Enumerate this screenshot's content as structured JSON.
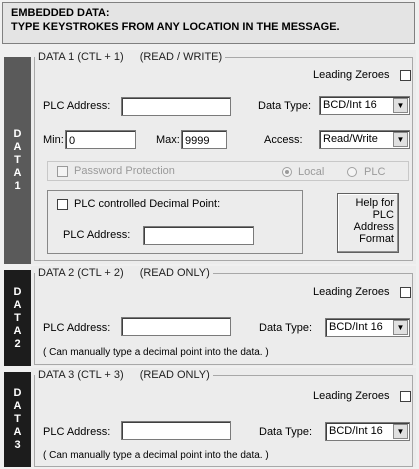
{
  "header": {
    "line1": "EMBEDDED DATA:",
    "line2": "TYPE KEYSTROKES FROM ANY LOCATION IN THE MESSAGE."
  },
  "sections": [
    {
      "side_letters": [
        "D",
        "A",
        "T",
        "A",
        "1"
      ],
      "legend": "DATA 1 (CTL + 1)",
      "mode": "(READ / WRITE)",
      "leading_zeroes": "Leading Zeroes",
      "plc_address_label": "PLC Address:",
      "plc_address_value": "",
      "data_type_label": "Data Type:",
      "data_type_value": "BCD/Int 16",
      "min_label": "Min:",
      "min_value": "0",
      "max_label": "Max:",
      "max_value": "9999",
      "access_label": "Access:",
      "access_value": "Read/Write",
      "password_protection": "Password Protection",
      "local_label": "Local",
      "plc_label": "PLC",
      "plc_decimal_label": "PLC controlled Decimal Point:",
      "plc_decimal_address_label": "PLC Address:",
      "plc_decimal_address_value": "",
      "help_button": [
        "Help for",
        "PLC",
        "Address",
        "Format"
      ]
    },
    {
      "side_letters": [
        "D",
        "A",
        "T",
        "A",
        "2"
      ],
      "legend": "DATA 2 (CTL + 2)",
      "mode": "(READ ONLY)",
      "leading_zeroes": "Leading Zeroes",
      "plc_address_label": "PLC Address:",
      "plc_address_value": "",
      "data_type_label": "Data Type:",
      "data_type_value": "BCD/Int 16",
      "note": "( Can manually type a decimal point into the data. )"
    },
    {
      "side_letters": [
        "D",
        "A",
        "T",
        "A",
        "3"
      ],
      "legend": "DATA 3 (CTL + 3)",
      "mode": "(READ ONLY)",
      "leading_zeroes": "Leading Zeroes",
      "plc_address_label": "PLC Address:",
      "plc_address_value": "",
      "data_type_label": "Data Type:",
      "data_type_value": "BCD/Int 16",
      "note": "( Can manually type a decimal point into the data. )"
    }
  ]
}
